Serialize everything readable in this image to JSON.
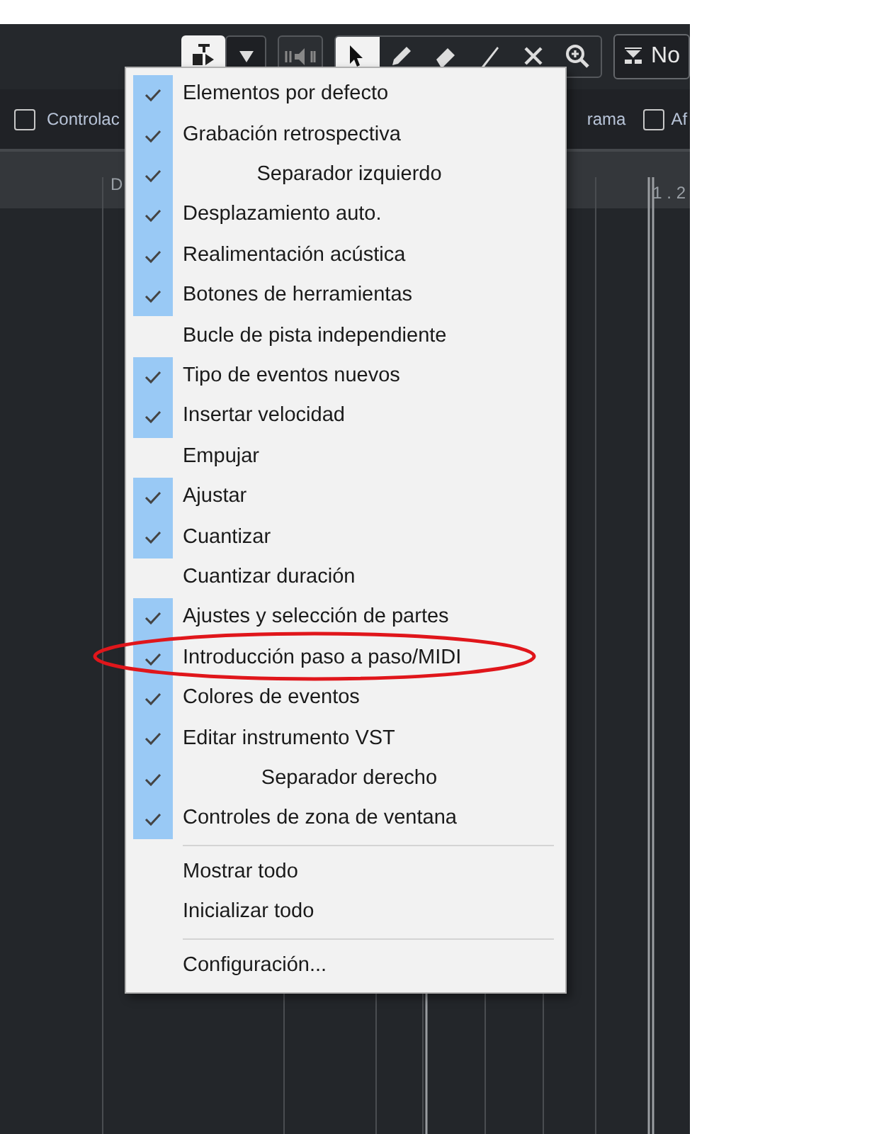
{
  "toolbar": {
    "mode_button": {
      "label": "No"
    },
    "options": [
      {
        "kind": "checkbox",
        "label": "Controlac",
        "checked": false
      },
      {
        "kind": "text",
        "label": "rama"
      },
      {
        "kind": "checkbox",
        "label": "Af",
        "checked": false
      }
    ]
  },
  "ruler": {
    "labels": [
      "D",
      "1 . 2"
    ]
  },
  "menu": {
    "sections": [
      [
        {
          "kind": "toggle",
          "label": "Elementos por defecto",
          "checked": true,
          "circled": false
        },
        {
          "kind": "toggle",
          "label": "Grabación retrospectiva",
          "checked": true,
          "circled": false
        },
        {
          "kind": "spacer",
          "label": "Separador izquierdo",
          "checked": true,
          "circled": false
        },
        {
          "kind": "toggle",
          "label": "Desplazamiento auto.",
          "checked": true,
          "circled": false
        },
        {
          "kind": "toggle",
          "label": "Realimentación acústica",
          "checked": true,
          "circled": false
        },
        {
          "kind": "toggle",
          "label": "Botones de herramientas",
          "checked": true,
          "circled": false
        },
        {
          "kind": "toggle",
          "label": "Bucle de pista independiente",
          "checked": false,
          "circled": false
        },
        {
          "kind": "toggle",
          "label": "Tipo de eventos nuevos",
          "checked": true,
          "circled": false
        },
        {
          "kind": "toggle",
          "label": "Insertar velocidad",
          "checked": true,
          "circled": false
        },
        {
          "kind": "toggle",
          "label": "Empujar",
          "checked": false,
          "circled": false
        },
        {
          "kind": "toggle",
          "label": "Ajustar",
          "checked": true,
          "circled": false
        },
        {
          "kind": "toggle",
          "label": "Cuantizar",
          "checked": true,
          "circled": false
        },
        {
          "kind": "toggle",
          "label": "Cuantizar duración",
          "checked": false,
          "circled": false
        },
        {
          "kind": "toggle",
          "label": "Ajustes y selección de partes",
          "checked": true,
          "circled": false
        },
        {
          "kind": "toggle",
          "label": "Introducción paso a paso/MIDI",
          "checked": true,
          "circled": true
        },
        {
          "kind": "toggle",
          "label": "Colores de eventos",
          "checked": true,
          "circled": false
        },
        {
          "kind": "toggle",
          "label": "Editar instrumento VST",
          "checked": true,
          "circled": false
        },
        {
          "kind": "spacer",
          "label": "Separador derecho",
          "checked": true,
          "circled": false
        },
        {
          "kind": "toggle",
          "label": "Controles de zona de ventana",
          "checked": true,
          "circled": false
        }
      ],
      [
        {
          "kind": "action",
          "label": "Mostrar todo"
        },
        {
          "kind": "action",
          "label": "Inicializar todo"
        }
      ],
      [
        {
          "kind": "action",
          "label": "Configuración..."
        }
      ]
    ]
  }
}
